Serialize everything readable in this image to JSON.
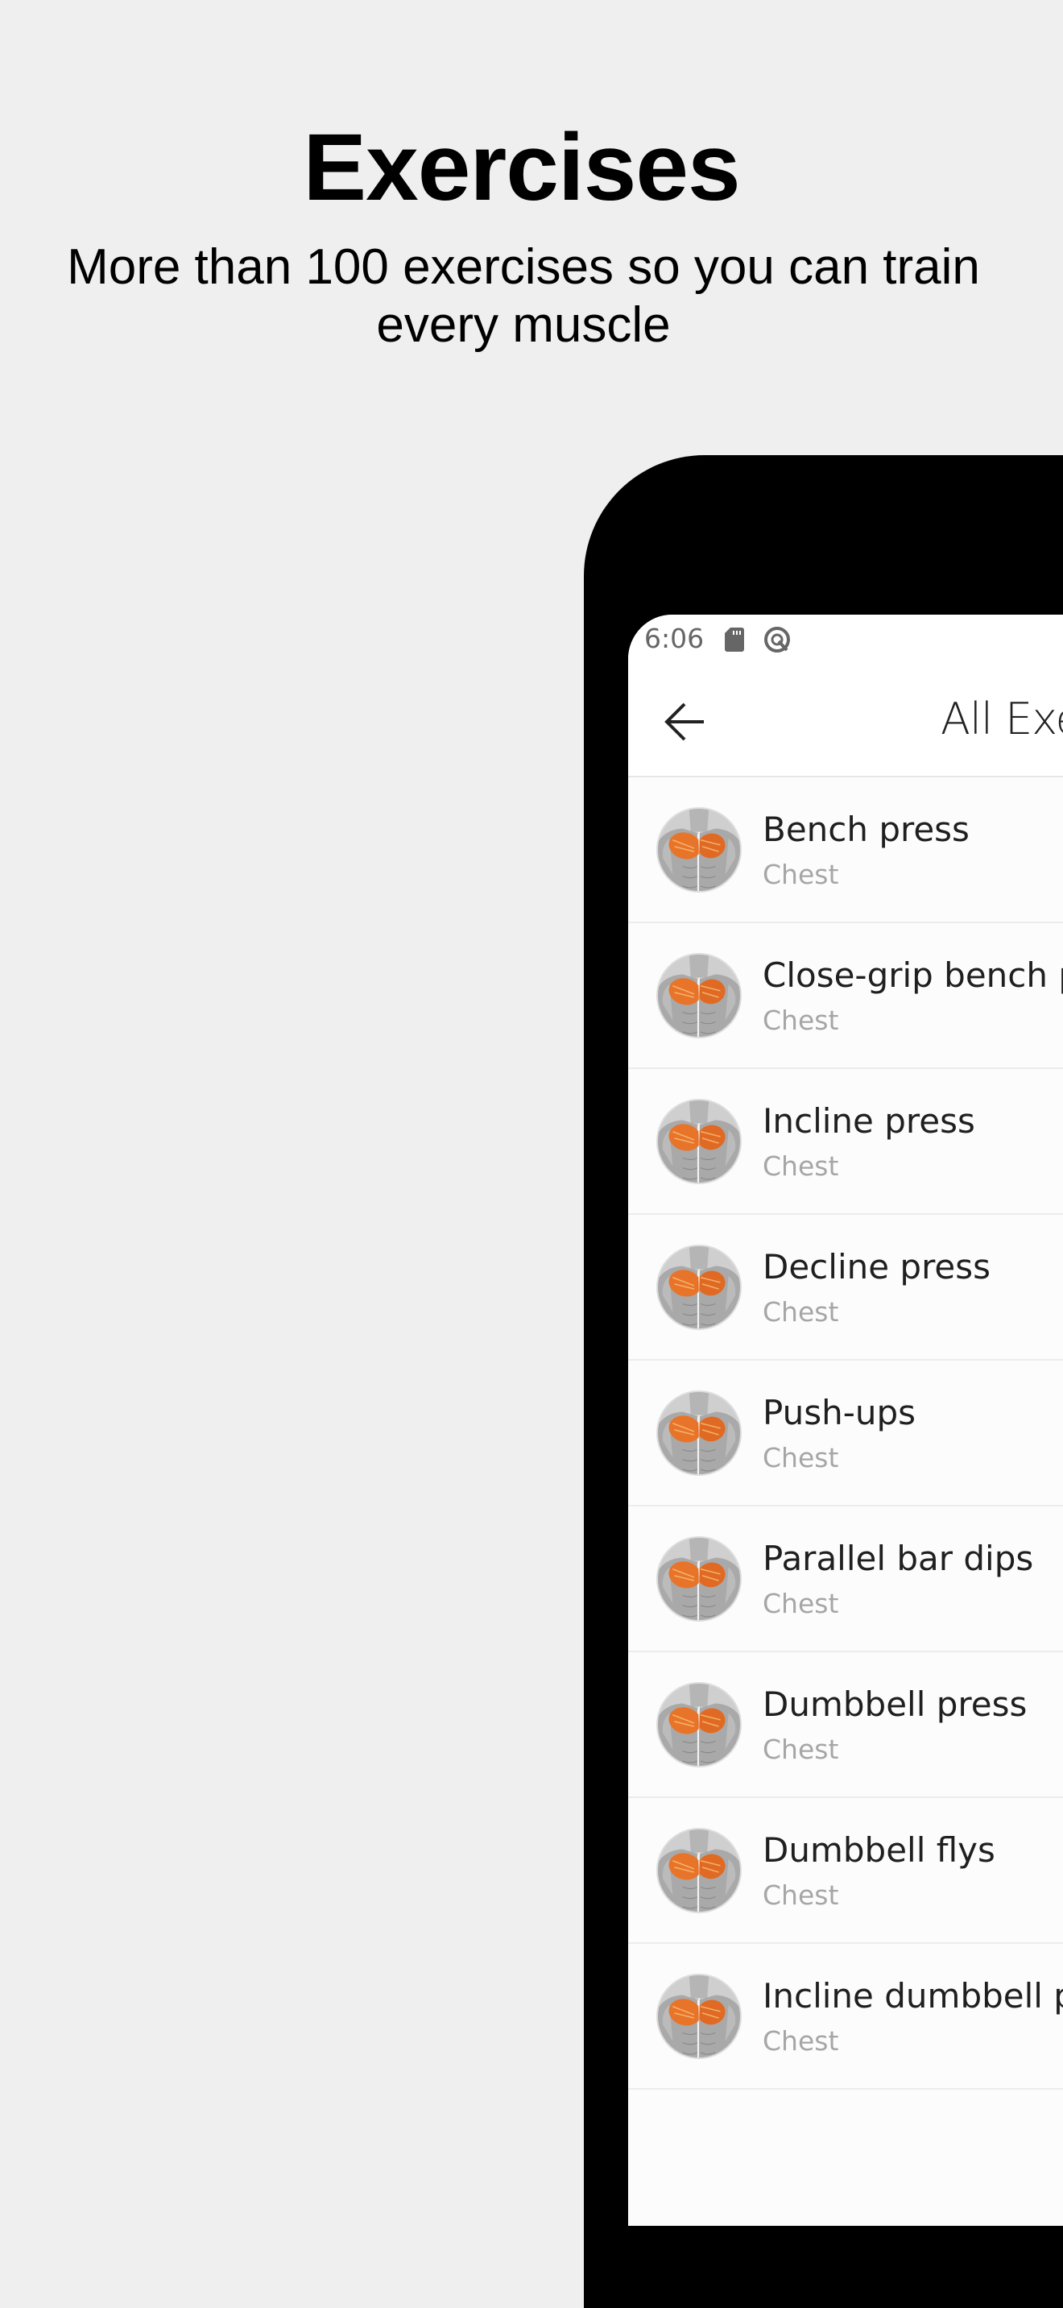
{
  "promo": {
    "title": "Exercises",
    "subtitle": "More than 100 exercises so you can train every muscle"
  },
  "status_bar": {
    "time": "6:06",
    "icons": [
      "sd-card-icon",
      "q-ring-icon"
    ]
  },
  "app_bar": {
    "back_icon": "arrow-left-icon",
    "title": "All Exercises"
  },
  "colors": {
    "page_background": "#efefef",
    "frame": "#000000",
    "screen_background": "#fcfcfc",
    "muscle_highlight": "#e8742a",
    "subtitle_text": "#a6a6a6"
  },
  "exercises": [
    {
      "name": "Bench press",
      "muscle": "Chest"
    },
    {
      "name": "Close-grip bench press",
      "muscle": "Chest"
    },
    {
      "name": "Incline press",
      "muscle": "Chest"
    },
    {
      "name": "Decline press",
      "muscle": "Chest"
    },
    {
      "name": "Push-ups",
      "muscle": "Chest"
    },
    {
      "name": "Parallel bar dips",
      "muscle": "Chest"
    },
    {
      "name": "Dumbbell press",
      "muscle": "Chest"
    },
    {
      "name": "Dumbbell flys",
      "muscle": "Chest"
    },
    {
      "name": "Incline dumbbell press",
      "muscle": "Chest"
    }
  ]
}
